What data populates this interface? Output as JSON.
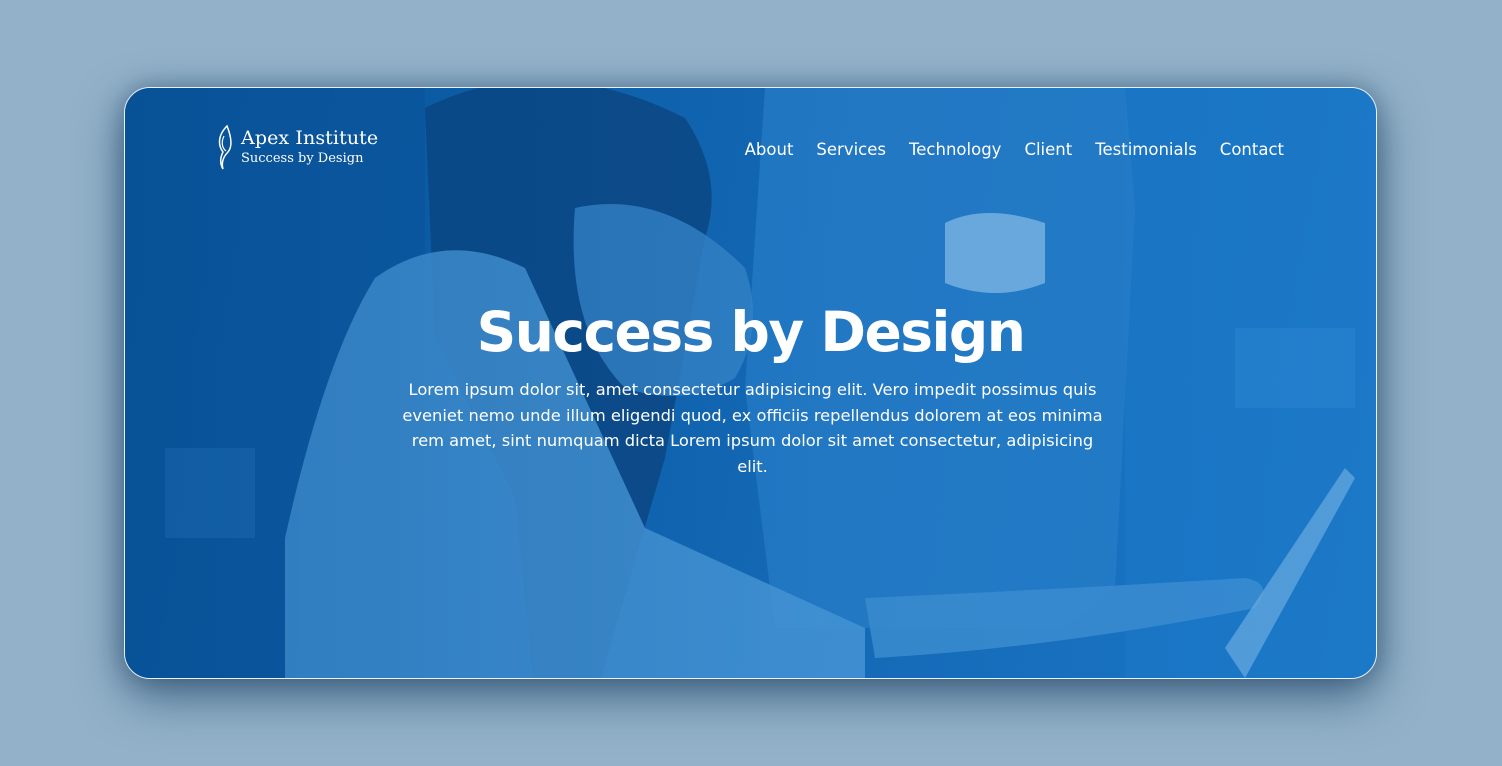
{
  "brand": {
    "name": "Apex Institute",
    "tagline": "Success by Design",
    "logo_icon": "flame-swoosh-icon"
  },
  "nav": {
    "items": [
      {
        "label": "About"
      },
      {
        "label": "Services"
      },
      {
        "label": "Technology"
      },
      {
        "label": "Client"
      },
      {
        "label": "Testimonials"
      },
      {
        "label": "Contact"
      }
    ]
  },
  "hero": {
    "title": "Success by Design",
    "body": "Lorem ipsum dolor sit, amet consectetur adipisicing elit. Vero impedit possimus quis eveniet nemo unde illum eligendi quod, ex officiis repellendus dolorem at eos minima rem amet, sint numquam dicta Lorem ipsum dolor sit amet consectetur, adipisicing elit."
  },
  "colors": {
    "overlay": "#1569b5",
    "page_background": "#93b2ca",
    "text": "#ffffff"
  }
}
